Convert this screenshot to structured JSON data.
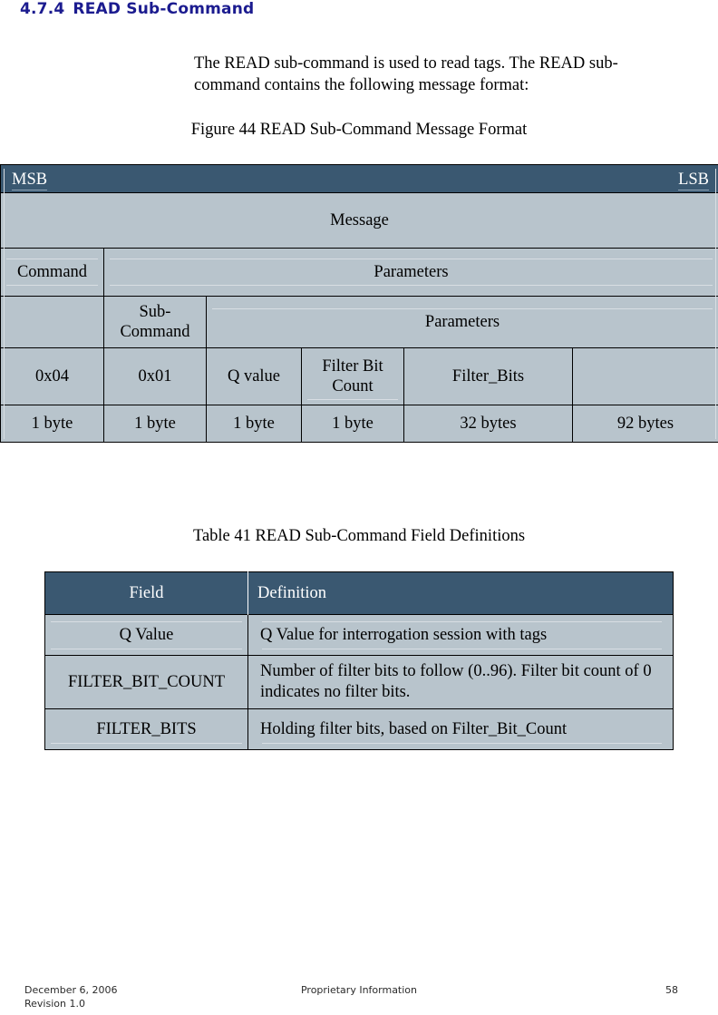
{
  "heading": {
    "number": "4.7.4",
    "title": "READ Sub-Command"
  },
  "body": {
    "paragraph": "The READ sub-command is used to read tags.  The READ sub-command contains the following message format:"
  },
  "figure": {
    "caption": "Figure 44 READ Sub-Command Message Format",
    "msb_label": "MSB",
    "lsb_label": "LSB",
    "message_label": "Message",
    "rows": {
      "level1": {
        "command": "Command",
        "parameters": "Parameters"
      },
      "level2": {
        "blank": "",
        "sub_command": "Sub-Command",
        "parameters": "Parameters"
      },
      "values": {
        "command": "0x04",
        "sub_command": "0x01",
        "q_value": "Q value",
        "filter_bit_count": "Filter Bit Count",
        "filter_bits": "Filter_Bits",
        "trailing": ""
      },
      "sizes": {
        "command": "1 byte",
        "sub_command": "1 byte",
        "q_value": "1 byte",
        "filter_bit_count": "1 byte",
        "filter_bits": "32 bytes",
        "trailing": "92 bytes"
      }
    }
  },
  "table41": {
    "caption": "Table 41 READ Sub-Command Field Definitions",
    "headers": {
      "field": "Field",
      "definition": "Definition"
    },
    "rows": [
      {
        "field": "Q Value",
        "definition": "Q Value for interrogation session with tags"
      },
      {
        "field": "FILTER_BIT_COUNT",
        "definition": "Number of filter bits to follow (0..96).  Filter bit count of 0 indicates no filter bits."
      },
      {
        "field": "FILTER_BITS",
        "definition": "Holding filter bits, based on Filter_Bit_Count"
      }
    ]
  },
  "footer": {
    "date": "December 6, 2006",
    "revision": "Revision 1.0",
    "center": "Proprietary Information",
    "page_number": "58"
  },
  "colors": {
    "heading": "#1b1b8f",
    "header_bar": "#3a5871",
    "cell_fill": "#b8c4cc",
    "inner_rule": "#d8dee3"
  }
}
